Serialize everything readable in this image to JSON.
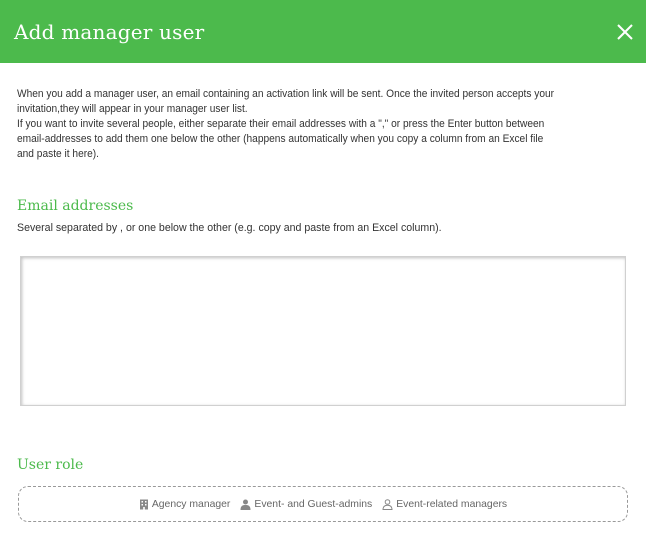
{
  "header": {
    "title": "Add manager user",
    "background": "#4cba4c",
    "close_icon": "close-icon"
  },
  "intro": {
    "line1": "When you add a manager user, an email containing an activation link will be sent. Once the invited person accepts your",
    "line2": "invitation,they will appear in your manager user list.",
    "line3": "If you want to invite several people, either separate their email addresses with a \",\" or press the Enter button between",
    "line4": "email-addresses to add them one below the other (happens automatically when you copy a column from an Excel file",
    "line5": "and paste it here)."
  },
  "email": {
    "title": "Email addresses",
    "hint": "Several separated by , or one below the other (e.g. copy and paste from an Excel column).",
    "value": "",
    "placeholder": ""
  },
  "role": {
    "title": "User role",
    "options": [
      {
        "label": "Agency manager",
        "icon": "building-icon"
      },
      {
        "label": "Event- and Guest-admins",
        "icon": "user-filled-icon"
      },
      {
        "label": "Event-related managers",
        "icon": "user-outline-icon"
      }
    ]
  },
  "colors": {
    "accent": "#4cba4c",
    "text": "#333333",
    "muted": "#666666"
  }
}
